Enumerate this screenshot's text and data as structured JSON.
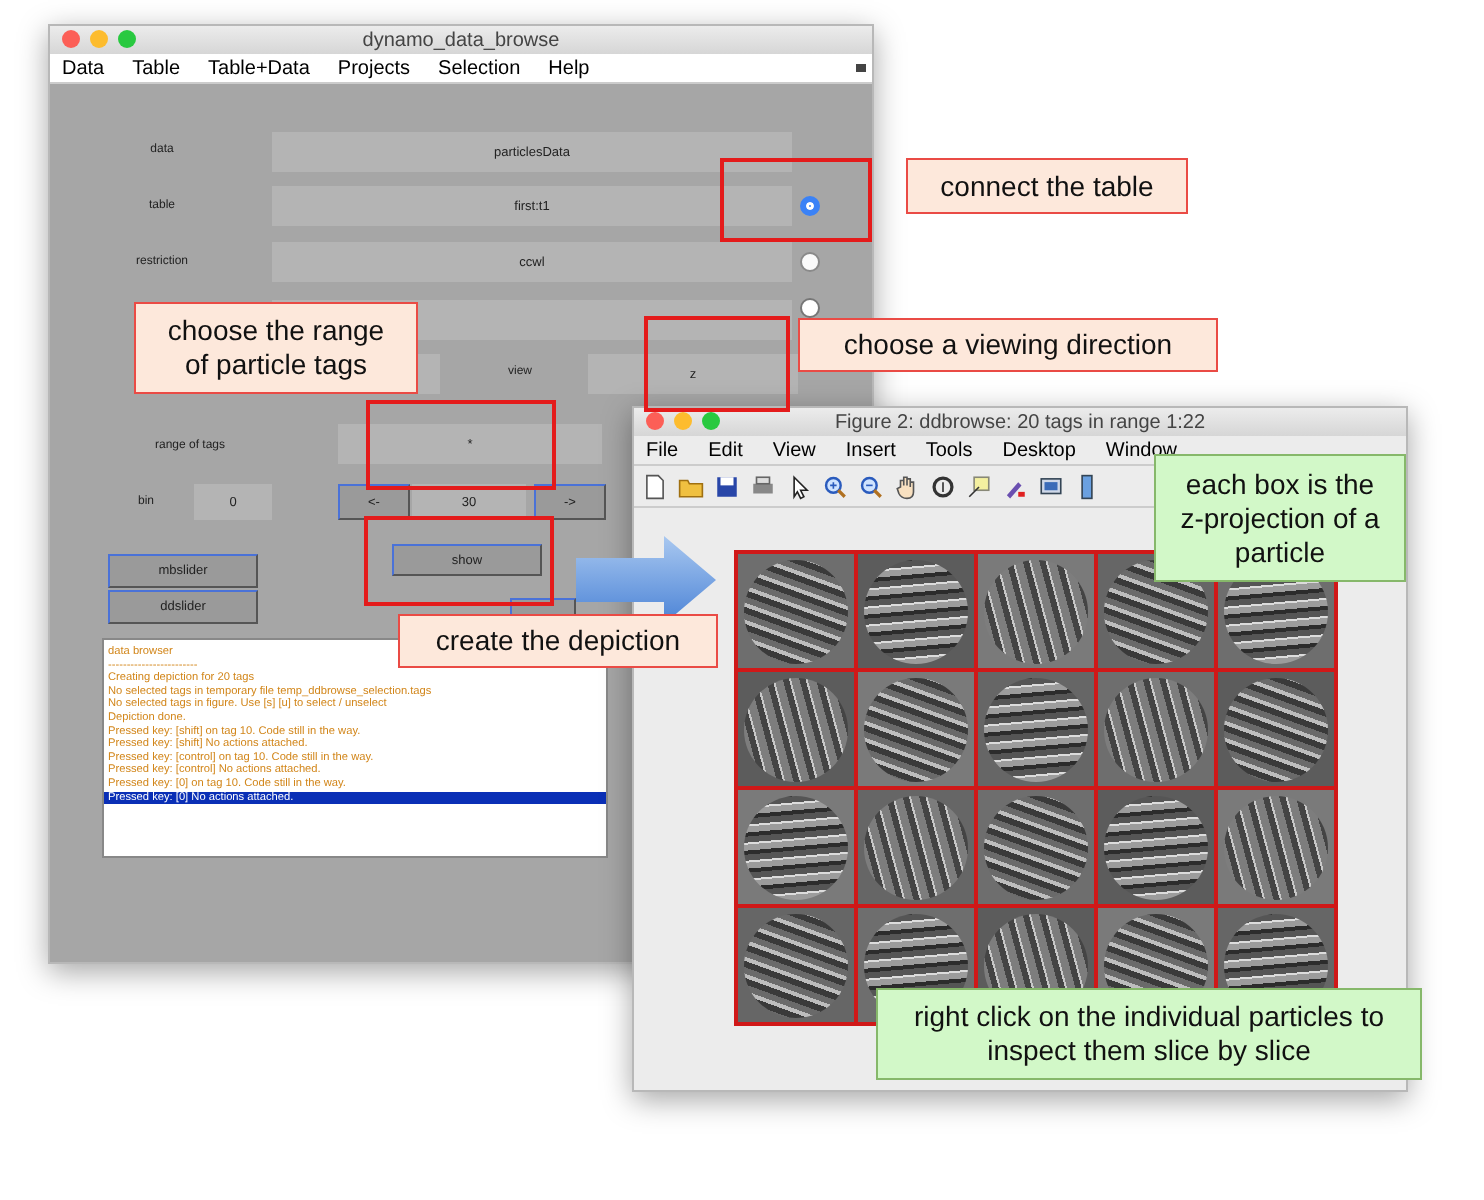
{
  "browser_window": {
    "title": "dynamo_data_browse",
    "menu": [
      "Data",
      "Table",
      "Table+Data",
      "Projects",
      "Selection",
      "Help"
    ],
    "source_rows": [
      {
        "label": "data",
        "value": "particlesData",
        "kind": "plain"
      },
      {
        "label": "table",
        "value": "first:t1",
        "kind": "radio",
        "selected": true
      },
      {
        "label": "restriction",
        "value": "ccwl",
        "kind": "radio",
        "selected": false
      },
      {
        "kind": "radio",
        "selected": false
      }
    ],
    "view": {
      "label": "view",
      "value": "z"
    },
    "range": {
      "label": "range of tags",
      "value": "*"
    },
    "bin": {
      "label": "bin",
      "value": "0",
      "prev": "<-",
      "size": "30",
      "next": "->"
    },
    "show_button": "show",
    "slider_buttons": [
      "mbslider",
      "ddslider"
    ],
    "log": [
      {
        "text": "data browser",
        "selected": false
      },
      {
        "text": "------------------------",
        "selected": false
      },
      {
        "text": "Creating depiction for 20 tags",
        "selected": false
      },
      {
        "text": "No selected tags in temporary file temp_ddbrowse_selection.tags",
        "selected": false
      },
      {
        "text": "No selected tags in figure. Use [s] [u] to select / unselect",
        "selected": false
      },
      {
        "text": "Depiction done.",
        "selected": false
      },
      {
        "text": "Pressed key: [shift] on tag 10.  Code still in the way.",
        "selected": false
      },
      {
        "text": "Pressed key: [shift]  No actions attached.",
        "selected": false
      },
      {
        "text": "Pressed key: [control] on tag 10.  Code still in the way.",
        "selected": false
      },
      {
        "text": "Pressed key: [control]  No actions attached.",
        "selected": false
      },
      {
        "text": "Pressed key: [0] on tag 10.  Code still in the way.",
        "selected": false
      },
      {
        "text": "Pressed key: [0]  No actions attached.",
        "selected": true
      }
    ]
  },
  "figure_window": {
    "title": "Figure 2: ddbrowse: 20 tags in range 1:22",
    "menu": [
      "File",
      "Edit",
      "View",
      "Insert",
      "Tools",
      "Desktop",
      "Window"
    ]
  },
  "callouts": [
    {
      "text": "connect the table",
      "kind": "step"
    },
    {
      "text": "choose the range of particle tags",
      "kind": "step"
    },
    {
      "text": "choose a viewing direction",
      "kind": "step"
    },
    {
      "text": "create the depiction",
      "kind": "step"
    },
    {
      "text": "each box is the z-projection of a particle",
      "kind": "note"
    },
    {
      "text": "right click on the individual particles to inspect them slice by slice",
      "kind": "note"
    }
  ]
}
